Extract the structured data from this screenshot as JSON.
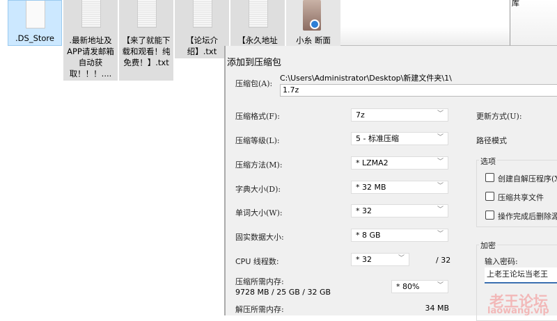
{
  "desktop": {
    "files": [
      {
        "name": ".DS_Store",
        "selected": true
      },
      {
        "name": ".最新地址及APP请发邮箱自动获取！！！...."
      },
      {
        "name": "【来了就能下载和观看！纯免费！】.txt"
      },
      {
        "name": "【论坛介绍】.txt"
      },
      {
        "name": "【永久地址"
      },
      {
        "name": "小糸 断面"
      }
    ],
    "right_window_text": "库"
  },
  "dialog": {
    "title": "添加到压缩包",
    "archive_label": "压缩包(A):",
    "archive_path": "C:\\Users\\Administrator\\Desktop\\新建文件夹\\1\\",
    "archive_name": "1.7z",
    "format": {
      "label": "压缩格式(F):",
      "value": "7z"
    },
    "level": {
      "label": "压缩等级(L):",
      "value": "5 - 标准压缩"
    },
    "method": {
      "label": "压缩方法(M):",
      "value": "*  LZMA2"
    },
    "dict": {
      "label": "字典大小(D):",
      "value": "*  32 MB"
    },
    "word": {
      "label": "单词大小(W):",
      "value": "*  32"
    },
    "solid": {
      "label": "固实数据大小:",
      "value": "*  8 GB"
    },
    "cpu": {
      "label": "CPU 线程数:",
      "value": "*  32",
      "max": "/ 32"
    },
    "mem": {
      "label": "压缩所需内存:",
      "value": "9728 MB / 25 GB / 32 GB",
      "percent": "*  80%"
    },
    "decomp": {
      "label": "解压所需内存:",
      "value": "34 MB"
    },
    "update_label": "更新方式(U):",
    "path_mode_label": "路径模式",
    "options": {
      "title": "选项",
      "items": [
        {
          "label": "创建自解压程序(X)",
          "checked": false
        },
        {
          "label": "压缩共享文件",
          "checked": false
        },
        {
          "label": "操作完成后删除源",
          "checked": false
        }
      ]
    },
    "encryption": {
      "title": "加密",
      "password_label": "输入密码:",
      "password": "上老王论坛当老王"
    }
  },
  "watermark": {
    "line1": "老王论坛",
    "line2": "laowang.vip"
  }
}
